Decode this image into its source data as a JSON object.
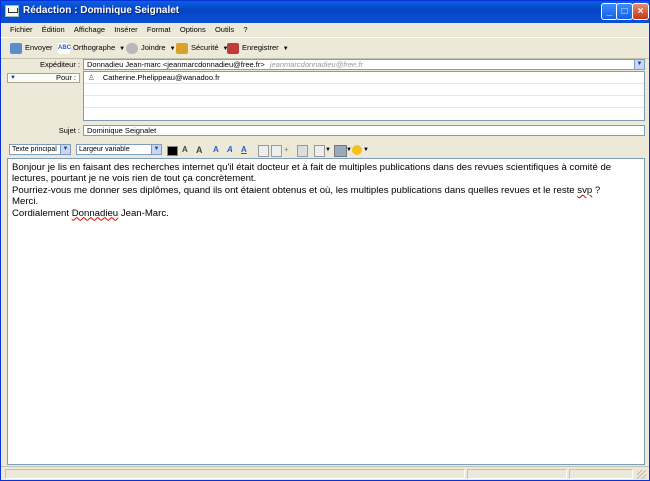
{
  "window": {
    "title": "Rédaction : Dominique Seignalet"
  },
  "menu": [
    "Fichier",
    "Édition",
    "Affichage",
    "Insérer",
    "Format",
    "Options",
    "Outils",
    "?"
  ],
  "toolbar": {
    "send": "Envoyer",
    "spelling": "Orthographe",
    "attach": "Joindre",
    "security": "Sécurité",
    "save": "Enregistrer"
  },
  "header": {
    "from_label": "Expéditeur :",
    "from_value": "Donnadieu Jean-marc <jeanmarcdonnadieu@free.fr>",
    "from_hint": "jeanmarcdonnadieu@free.fr",
    "to_label": "Pour :",
    "to_value": "Catherine.Phelippeau@wanadoo.fr",
    "subject_label": "Sujet :",
    "subject_value": "Dominique Seignalet"
  },
  "format": {
    "paragraph_style": "Texte principal",
    "font": "Largeur variable"
  },
  "message": {
    "line1": "Bonjour je lis en faisant des recherches internet qu'il était docteur et à fait de multiples publications dans des revues scientifiques à comité de",
    "line2": "lectures, pourtant je ne vois rien de tout ça concrètement.",
    "line3a": "Pourriez-vous me donner ses diplômes, quand ils ont étaient obtenus et où, les multiples publications dans quelles revues et le reste ",
    "line3b": "svp",
    "line3c": " ?",
    "line4": "Merci.",
    "line5a": "Cordialement ",
    "line5b": "Donnadieu",
    "line5c": " Jean-Marc."
  },
  "colors": {
    "titlebar": "#0545c4",
    "chrome": "#ece9d8",
    "field_border": "#7f9db9"
  }
}
